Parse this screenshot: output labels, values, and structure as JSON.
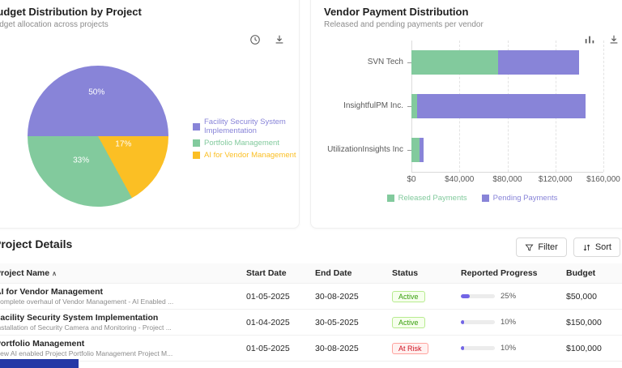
{
  "budget_card": {
    "title": "Budget Distribution by Project",
    "subtitle": "Budget allocation across projects",
    "icons": [
      "clock-icon",
      "download-icon"
    ]
  },
  "vendor_card": {
    "title": "Vendor Payment Distribution",
    "subtitle": "Released and pending payments per vendor",
    "icons": [
      "bar-chart-icon",
      "download-icon"
    ]
  },
  "chart_data": [
    {
      "type": "pie",
      "title": "Budget Distribution by Project",
      "slices": [
        {
          "label": "Facility Security System Implementation",
          "value": 50,
          "display": "50%",
          "color": "#8884d8"
        },
        {
          "label": "AI for Vendor Management",
          "value": 17,
          "display": "17%",
          "color": "#fbbf24"
        },
        {
          "label": "Portfolio Management",
          "value": 33,
          "display": "33%",
          "color": "#82ca9d"
        }
      ],
      "legend": [
        {
          "label": "Facility Security System Implementation",
          "color": "#8884d8"
        },
        {
          "label": "Portfolio Management",
          "color": "#82ca9d"
        },
        {
          "label": "AI for Vendor Management",
          "color": "#fbbf24"
        }
      ],
      "legend_position": "right"
    },
    {
      "type": "bar",
      "orientation": "horizontal",
      "stacked": true,
      "categories": [
        "SVN Tech",
        "InsightfulPM Inc.",
        "UtilizationInsights Inc"
      ],
      "series": [
        {
          "name": "Released Payments",
          "color": "#82ca9d",
          "values": [
            72000,
            5000,
            7000
          ]
        },
        {
          "name": "Pending Payments",
          "color": "#8884d8",
          "values": [
            68000,
            140000,
            3000
          ]
        }
      ],
      "xmax": 160000,
      "xticks": [
        "$0",
        "$40,000",
        "$80,000",
        "$120,000",
        "$160,000"
      ],
      "grid": "dashed-vertical",
      "legend_position": "bottom"
    }
  ],
  "project_details": {
    "title": "Project Details",
    "filter_label": "Filter",
    "sort_label": "Sort",
    "sort_caret": "∧",
    "columns": [
      "Project Name",
      "Start Date",
      "End Date",
      "Status",
      "Reported Progress",
      "Budget"
    ],
    "rows": [
      {
        "name": "AI for Vendor Management",
        "description": "Complete overhaul of Vendor Management - AI Enabled ...",
        "start": "01-05-2025",
        "end": "30-08-2025",
        "status": "Active",
        "progress": 25,
        "progress_label": "25%",
        "budget": "$50,000"
      },
      {
        "name": "Facility Security System Implementation",
        "description": "Installation of Security Camera and Monitoring - Project ...",
        "start": "01-04-2025",
        "end": "30-05-2025",
        "status": "Active",
        "progress": 10,
        "progress_label": "10%",
        "budget": "$150,000"
      },
      {
        "name": "Portfolio Management",
        "description": "New AI enabled Project Portfolio Management Project M...",
        "start": "01-05-2025",
        "end": "30-08-2025",
        "status": "At Risk",
        "progress": 10,
        "progress_label": "10%",
        "budget": "$100,000"
      }
    ]
  }
}
